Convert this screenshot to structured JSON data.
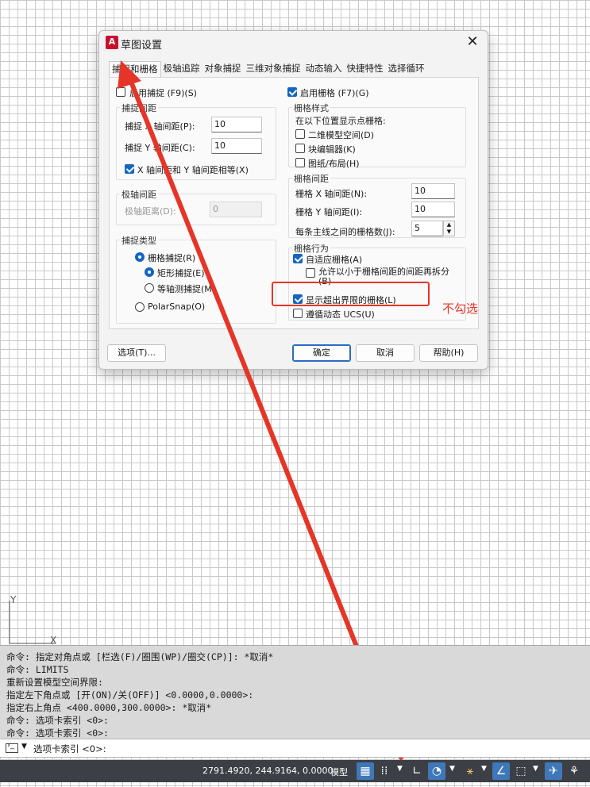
{
  "dialog": {
    "title": "草图设置",
    "app_icon_letter": "A",
    "close_glyph": "✕",
    "tabs": [
      "捕捉和栅格",
      "极轴追踪",
      "对象捕捉",
      "三维对象捕捉",
      "动态输入",
      "快捷特性",
      "选择循环"
    ],
    "active_tab": 0,
    "snap_enable": {
      "label": "启用捕捉 (F9)(S)",
      "checked": false
    },
    "snap_spacing": {
      "legend": "捕捉间距",
      "x_label": "捕捉 X 轴间距(P):",
      "x_value": "10",
      "y_label": "捕捉 Y 轴间距(C):",
      "y_value": "10",
      "equal_label": "X 轴间距和 Y 轴间距相等(X)",
      "equal_checked": true
    },
    "polar_spacing": {
      "legend": "极轴间距",
      "label": "极轴距离(D):",
      "value": "0"
    },
    "snap_type": {
      "legend": "捕捉类型",
      "grid_snap": "栅格捕捉(R)",
      "rect_snap": "矩形捕捉(E)",
      "iso_snap": "等轴测捕捉(M)",
      "polar_snap": "PolarSnap(O)"
    },
    "grid_enable": {
      "label": "启用栅格 (F7)(G)",
      "checked": true
    },
    "grid_style": {
      "legend": "栅格样式",
      "caption": "在以下位置显示点栅格:",
      "model_space": "二维模型空间(D)",
      "block_editor": "块编辑器(K)",
      "paper_layout": "图纸/布局(H)"
    },
    "grid_spacing": {
      "legend": "栅格间距",
      "x_label": "栅格 X 轴间距(N):",
      "x_value": "10",
      "y_label": "栅格 Y 轴间距(I):",
      "y_value": "10",
      "major_label": "每条主线之间的栅格数(J):",
      "major_value": "5"
    },
    "grid_behavior": {
      "legend": "栅格行为",
      "adaptive": "自适应栅格(A)",
      "subdivide": "允许以小于栅格间距的间距再拆分(B)",
      "beyond_limits": "显示超出界限的栅格(L)",
      "follow_ucs": "遵循动态 UCS(U)"
    },
    "buttons": {
      "options": "选项(T)...",
      "ok": "确定",
      "cancel": "取消",
      "help": "帮助(H)"
    }
  },
  "annotation": {
    "text": "不勾选",
    "color": "#e53528"
  },
  "ucs": {
    "y_label": "Y",
    "x_label": "X"
  },
  "command_history": [
    "命令: 指定对角点或 [栏选(F)/圈围(WP)/圈交(CP)]: *取消*",
    "命令: LIMITS",
    "重新设置模型空间界限:",
    "指定左下角点或 [开(ON)/关(OFF)] <0.0000,0.0000>:",
    "指定右上角点 <400.0000,300.0000>: *取消*",
    "命令:  选项卡索引 <0>:",
    "命令:  选项卡索引 <0>:"
  ],
  "command_prompt": "选项卡索引 <0>:",
  "status": {
    "coords": "2791.4920, 244.9164, 0.0000",
    "model": "模型"
  },
  "colors": {
    "accent": "#1565c0",
    "statusbar": "#3c3f45"
  }
}
